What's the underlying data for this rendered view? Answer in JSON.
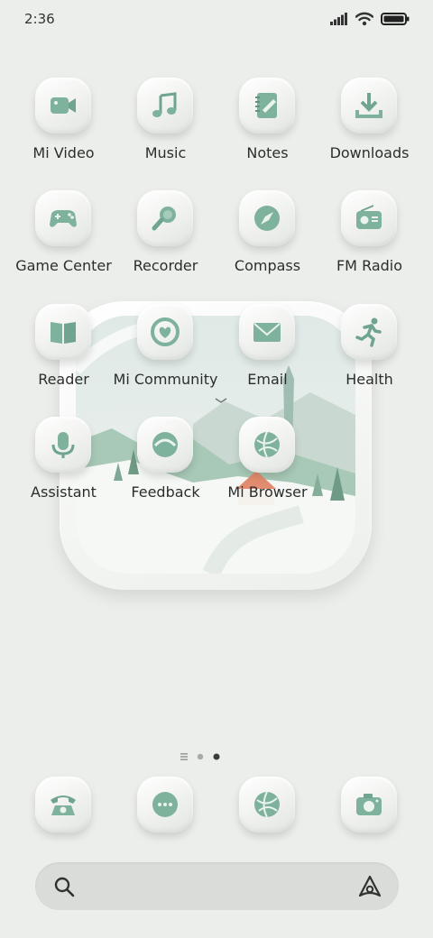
{
  "status": {
    "time": "2:36"
  },
  "apps": [
    {
      "label": "Mi Video",
      "icon": "video-camera-icon"
    },
    {
      "label": "Music",
      "icon": "music-note-icon"
    },
    {
      "label": "Notes",
      "icon": "notepad-icon"
    },
    {
      "label": "Downloads",
      "icon": "download-icon"
    },
    {
      "label": "Game Center",
      "icon": "gamepad-icon"
    },
    {
      "label": "Recorder",
      "icon": "microphone-recorder-icon"
    },
    {
      "label": "Compass",
      "icon": "compass-icon"
    },
    {
      "label": "FM Radio",
      "icon": "radio-icon"
    },
    {
      "label": "Reader",
      "icon": "book-icon"
    },
    {
      "label": "Mi Community",
      "icon": "heart-icon"
    },
    {
      "label": "Email",
      "icon": "envelope-icon"
    },
    {
      "label": "Health",
      "icon": "running-person-icon"
    },
    {
      "label": "Assistant",
      "icon": "assistant-mic-icon"
    },
    {
      "label": "Feedback",
      "icon": "feedback-icon"
    },
    {
      "label": "Mi Browser",
      "icon": "globe-icon"
    }
  ],
  "dock": [
    {
      "icon": "phone-icon"
    },
    {
      "icon": "messages-icon"
    },
    {
      "icon": "browser-globe-icon"
    },
    {
      "icon": "camera-icon"
    }
  ],
  "pager": {
    "pages": 3,
    "current": 3
  },
  "colors": {
    "accent": "#8bbaa6",
    "accent_dark": "#6fa590",
    "background": "#eceeeb"
  }
}
